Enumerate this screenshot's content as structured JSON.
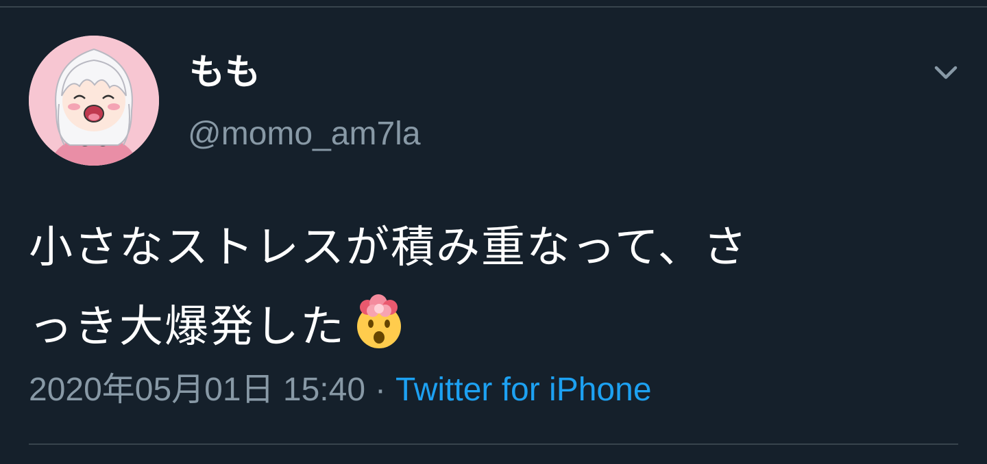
{
  "user": {
    "display_name": "もも",
    "handle": "@momo_am7la",
    "avatar": "anime-girl-avatar"
  },
  "tweet": {
    "text_line1": "小さなストレスが積み重なって、さ",
    "text_line2": "っき大爆発した",
    "emoji": "exploding-head-icon"
  },
  "meta": {
    "timestamp": "2020年05月01日 15:40",
    "separator": "·",
    "source": "Twitter for iPhone"
  },
  "menu": {
    "icon": "chevron-down-icon"
  },
  "colors": {
    "background": "#15202b",
    "divider": "#38444d",
    "primary_text": "#ffffff",
    "secondary_text": "#8899a6",
    "link": "#1da1f2"
  }
}
